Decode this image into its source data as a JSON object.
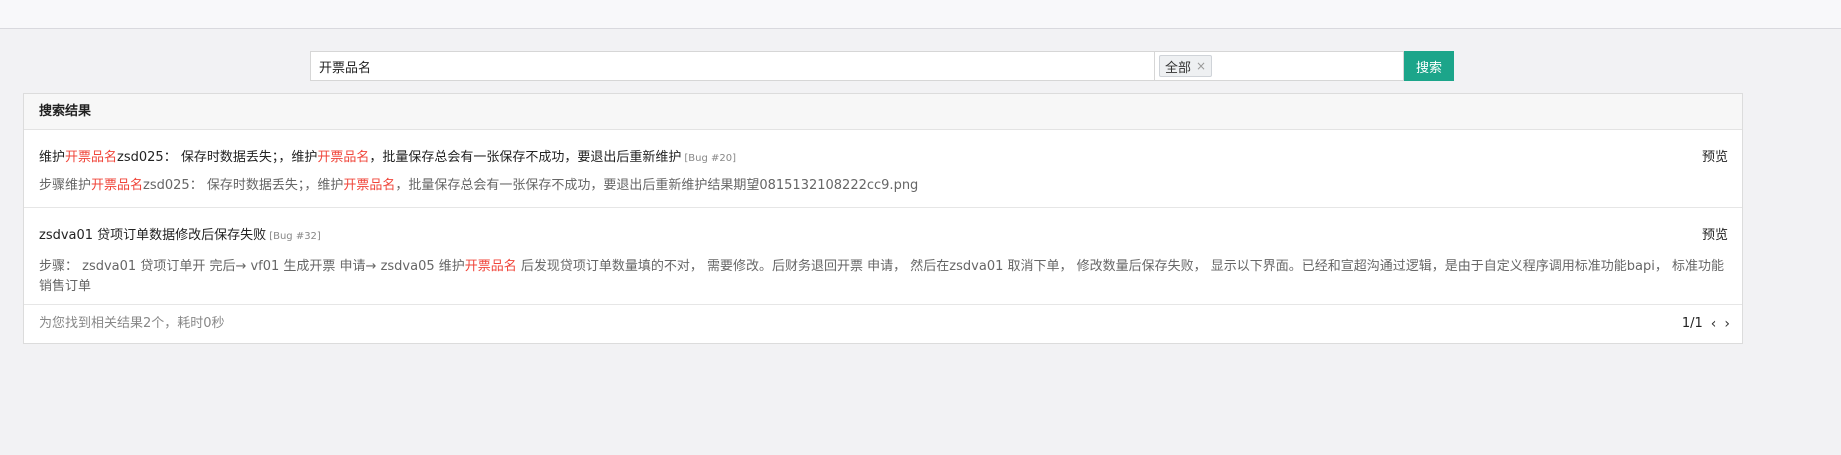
{
  "search": {
    "query": "开票品名",
    "scope_tag": "全部",
    "scope_remove": "×",
    "button_label": "搜索"
  },
  "panel": {
    "header": "搜索结果"
  },
  "results": [
    {
      "title_parts": [
        "维护",
        "开票品名",
        "zsd025： 保存时数据丢失；，维护",
        "开票品名",
        "，批量保存总会有一张保存不成功，要退出后重新维护"
      ],
      "bug_ref": "[Bug #20]",
      "preview": "预览",
      "body_parts": [
        "步骤维护",
        "开票品名",
        "zsd025： 保存时数据丢失；，维护",
        "开票品名",
        "，批量保存总会有一张保存不成功，要退出后重新维护结果期望0815132108222cc9.png"
      ]
    },
    {
      "title": "zsdva01 贷项订单数据修改后保存失败",
      "bug_ref": "[Bug #32]",
      "preview": "预览",
      "body_parts": [
        "步骤： zsdva01 贷项订单开 完后→ vf01 生成开票 申请→ zsdva05 维护",
        "开票品名",
        " 后发现贷项订单数量填的不对， 需要修改。后财务退回开票 申请， 然后在zsdva01 取消下单， 修改数量后保存失败， 显示以下界面。已经和宣超沟通过逻辑，是由于自定义程序调用标准功能bapi， 标准功能销售订单"
      ]
    }
  ],
  "footer": {
    "summary": "为您找到相关结果2个，耗时0秒",
    "page": "1/1",
    "prev": "‹",
    "next": "›"
  },
  "colors": {
    "highlight": "#f0453a",
    "search_button": "#1ca58a"
  }
}
